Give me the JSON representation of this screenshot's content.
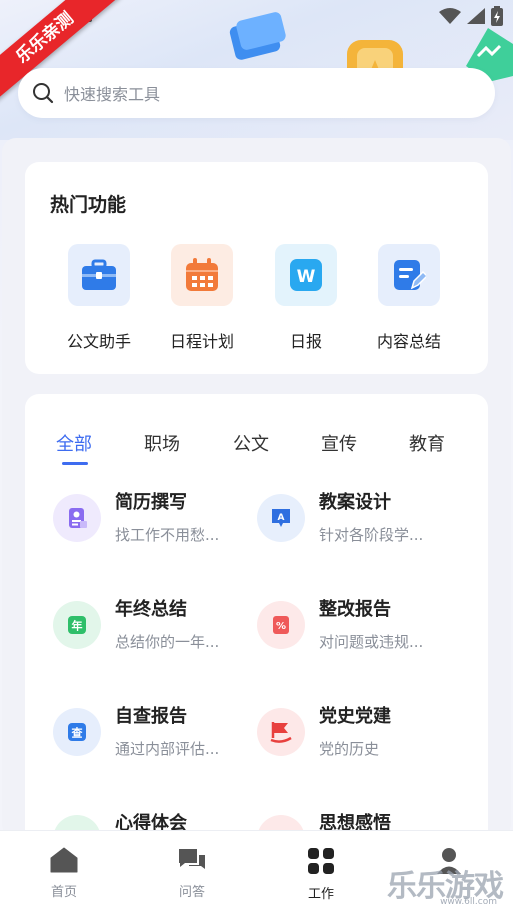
{
  "ribbon": "乐乐亲测",
  "search": {
    "placeholder": "快速搜索工具"
  },
  "hot": {
    "title": "热门功能",
    "items": [
      {
        "label": "公文助手",
        "icon": "briefcase-icon",
        "color": "#2f7be8",
        "bg": "#e6eefc"
      },
      {
        "label": "日程计划",
        "icon": "calendar-icon",
        "color": "#f27a3a",
        "bg": "#fdece3"
      },
      {
        "label": "日报",
        "icon": "word-doc-icon",
        "color": "#29a8f0",
        "bg": "#e3f3fc",
        "glyph": "W"
      },
      {
        "label": "内容总结",
        "icon": "edit-note-icon",
        "color": "#2f7be8",
        "bg": "#e6eefc"
      }
    ]
  },
  "tabs": [
    "全部",
    "职场",
    "公文",
    "宣传",
    "教育"
  ],
  "tools": [
    {
      "title": "简历撰写",
      "desc": "找工作不用愁...",
      "icon": "resume-icon",
      "color": "#8a6cf0",
      "bg": "#efeafd",
      "glyph": ""
    },
    {
      "title": "教案设计",
      "desc": "针对各阶段学...",
      "icon": "lesson-plan-icon",
      "color": "#2f6fe0",
      "bg": "#e7effc",
      "glyph": "A"
    },
    {
      "title": "年终总结",
      "desc": "总结你的一年...",
      "icon": "year-summary-icon",
      "color": "#2fbf6a",
      "bg": "#e2f6ea",
      "glyph": "年"
    },
    {
      "title": "整改报告",
      "desc": "对问题或违规...",
      "icon": "rectify-report-icon",
      "color": "#ef5a5a",
      "bg": "#fde9e9",
      "glyph": "%"
    },
    {
      "title": "自查报告",
      "desc": "通过内部评估...",
      "icon": "self-check-icon",
      "color": "#2f7be8",
      "bg": "#e6eefc",
      "glyph": "查"
    },
    {
      "title": "党史党建",
      "desc": "党的历史",
      "icon": "party-flag-icon",
      "color": "#e8403e",
      "bg": "#fde8e8",
      "glyph": ""
    },
    {
      "title": "心得体会",
      "desc": "",
      "icon": "insight-icon",
      "color": "#2fbf6a",
      "bg": "#e2f6ea",
      "glyph": ""
    },
    {
      "title": "思想感悟",
      "desc": "",
      "icon": "thought-icon",
      "color": "#ef5a5a",
      "bg": "#fde9e9",
      "glyph": ""
    }
  ],
  "nav": [
    {
      "label": "首页",
      "icon": "home-icon"
    },
    {
      "label": "问答",
      "icon": "chat-icon"
    },
    {
      "label": "工作",
      "icon": "grid-icon"
    },
    {
      "label": "我的",
      "icon": "profile-icon"
    }
  ],
  "watermark": {
    "text": "乐乐游戏",
    "url": "www.6ll.com"
  }
}
